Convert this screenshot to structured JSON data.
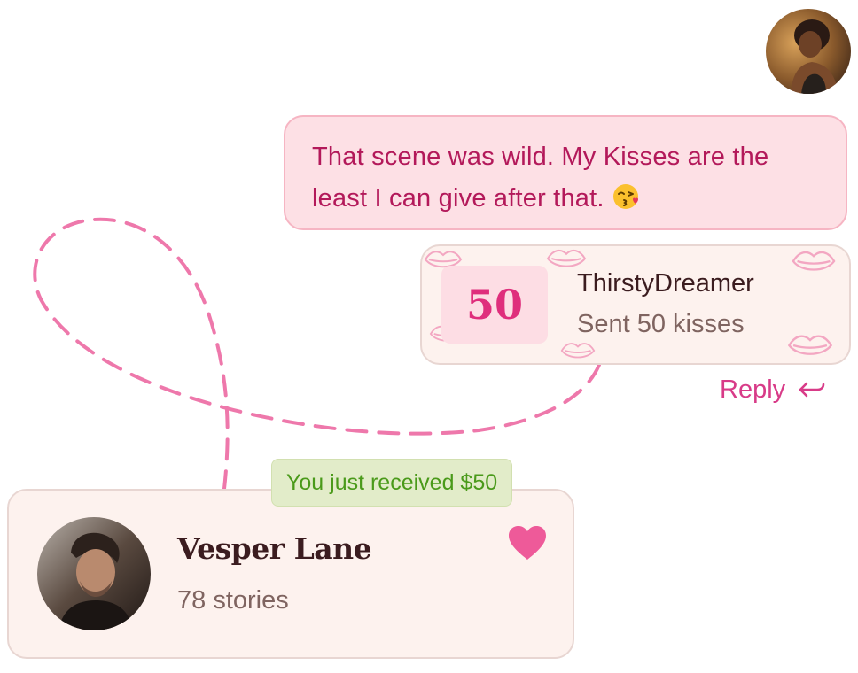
{
  "message": {
    "text": "That scene was wild. My Kisses are the least I can give after that.",
    "emoji": "face-blowing-a-kiss"
  },
  "kiss_notification": {
    "amount": "50",
    "sender_name": "ThirstyDreamer",
    "description": "Sent 50 kisses"
  },
  "reply": {
    "label": "Reply",
    "icon": "reply-arrow-icon"
  },
  "received_badge": {
    "text": "You just received $50"
  },
  "profile": {
    "name": "Vesper Lane",
    "stories": "78 stories",
    "favorite_icon": "heart-icon"
  },
  "colors": {
    "accent_pink": "#df2e7c",
    "bubble_bg": "#fde0e5",
    "card_bg": "#fdf2ee",
    "badge_green": "#4a9a1a",
    "badge_bg": "#e2ecc9",
    "dashed_line": "#ee78ab"
  }
}
